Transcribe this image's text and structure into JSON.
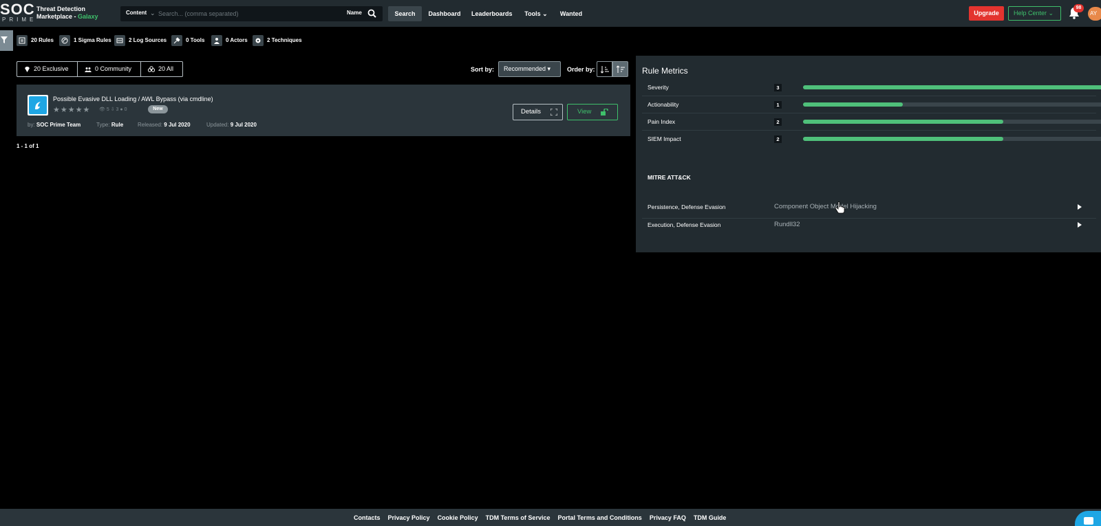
{
  "header": {
    "logo_main": "SOC",
    "logo_sub": "PRIME",
    "brand_line1": "Threat Detection",
    "brand_line2": "Marketplace - ",
    "brand_accent": "Galaxy",
    "search": {
      "content_label": "Content",
      "placeholder": "Search... (comma separated)",
      "name_label": "Name"
    },
    "nav": {
      "search": "Search",
      "dashboard": "Dashboard",
      "leaderboards": "Leaderboards",
      "tools": "Tools",
      "wanted": "Wanted"
    },
    "upgrade": "Upgrade",
    "help_center": "Help Center",
    "notifications_count": "98",
    "avatar_initials": "AY"
  },
  "stats": [
    {
      "icon": "rules-icon",
      "label": "20 Rules"
    },
    {
      "icon": "sigma-icon",
      "label": "1 Sigma Rules"
    },
    {
      "icon": "log-sources-icon",
      "label": "2 Log Sources"
    },
    {
      "icon": "tools-icon",
      "label": "0 Tools"
    },
    {
      "icon": "actors-icon",
      "label": "0 Actors"
    },
    {
      "icon": "techniques-icon",
      "label": "2 Techniques"
    }
  ],
  "filters": {
    "exclusive": "20 Exclusive",
    "community": "0 Community",
    "all": "20 All",
    "sort_label": "Sort by:",
    "sort_value": "Recommended",
    "order_label": "Order by:"
  },
  "rule": {
    "title": "Possible Evasive DLL Loading / AWL Bypass (via cmdline)",
    "views": "5",
    "downloads": "3",
    "comments": "0",
    "badge": "New",
    "by_label": "by:",
    "author": "SOC Prime Team",
    "type_label": "Type:",
    "type": "Rule",
    "released_label": "Released:",
    "released": "9 Jul 2020",
    "updated_label": "Updated:",
    "updated": "9 Jul 2020",
    "details_label": "Details",
    "view_label": "View"
  },
  "pager": "1 - 1 of 1",
  "metrics": {
    "title": "Rule Metrics",
    "max": 3,
    "items": [
      {
        "label": "Severity",
        "value": "3",
        "level": 1.0
      },
      {
        "label": "Actionability",
        "value": "1",
        "level": 0.333
      },
      {
        "label": "Pain Index",
        "value": "2",
        "level": 0.667
      },
      {
        "label": "SIEM Impact",
        "value": "2",
        "level": 0.667
      }
    ]
  },
  "mitre": {
    "title": "MITRE ATT&CK",
    "rows": [
      {
        "tactic": "Persistence, Defense Evasion",
        "technique": "Component Object Model Hijacking"
      },
      {
        "tactic": "Execution, Defense Evasion",
        "technique": "Rundll32"
      }
    ]
  },
  "footer": {
    "links": [
      "Contacts",
      "Privacy Policy",
      "Cookie Policy",
      "TDM Terms of Service",
      "Portal Terms and Conditions",
      "Privacy FAQ",
      "TDM Guide"
    ]
  },
  "colors": {
    "accent_green": "#3fc06b",
    "upgrade_red": "#e3342f",
    "panel_bg": "#222b30",
    "card_bg": "#2b353b"
  }
}
